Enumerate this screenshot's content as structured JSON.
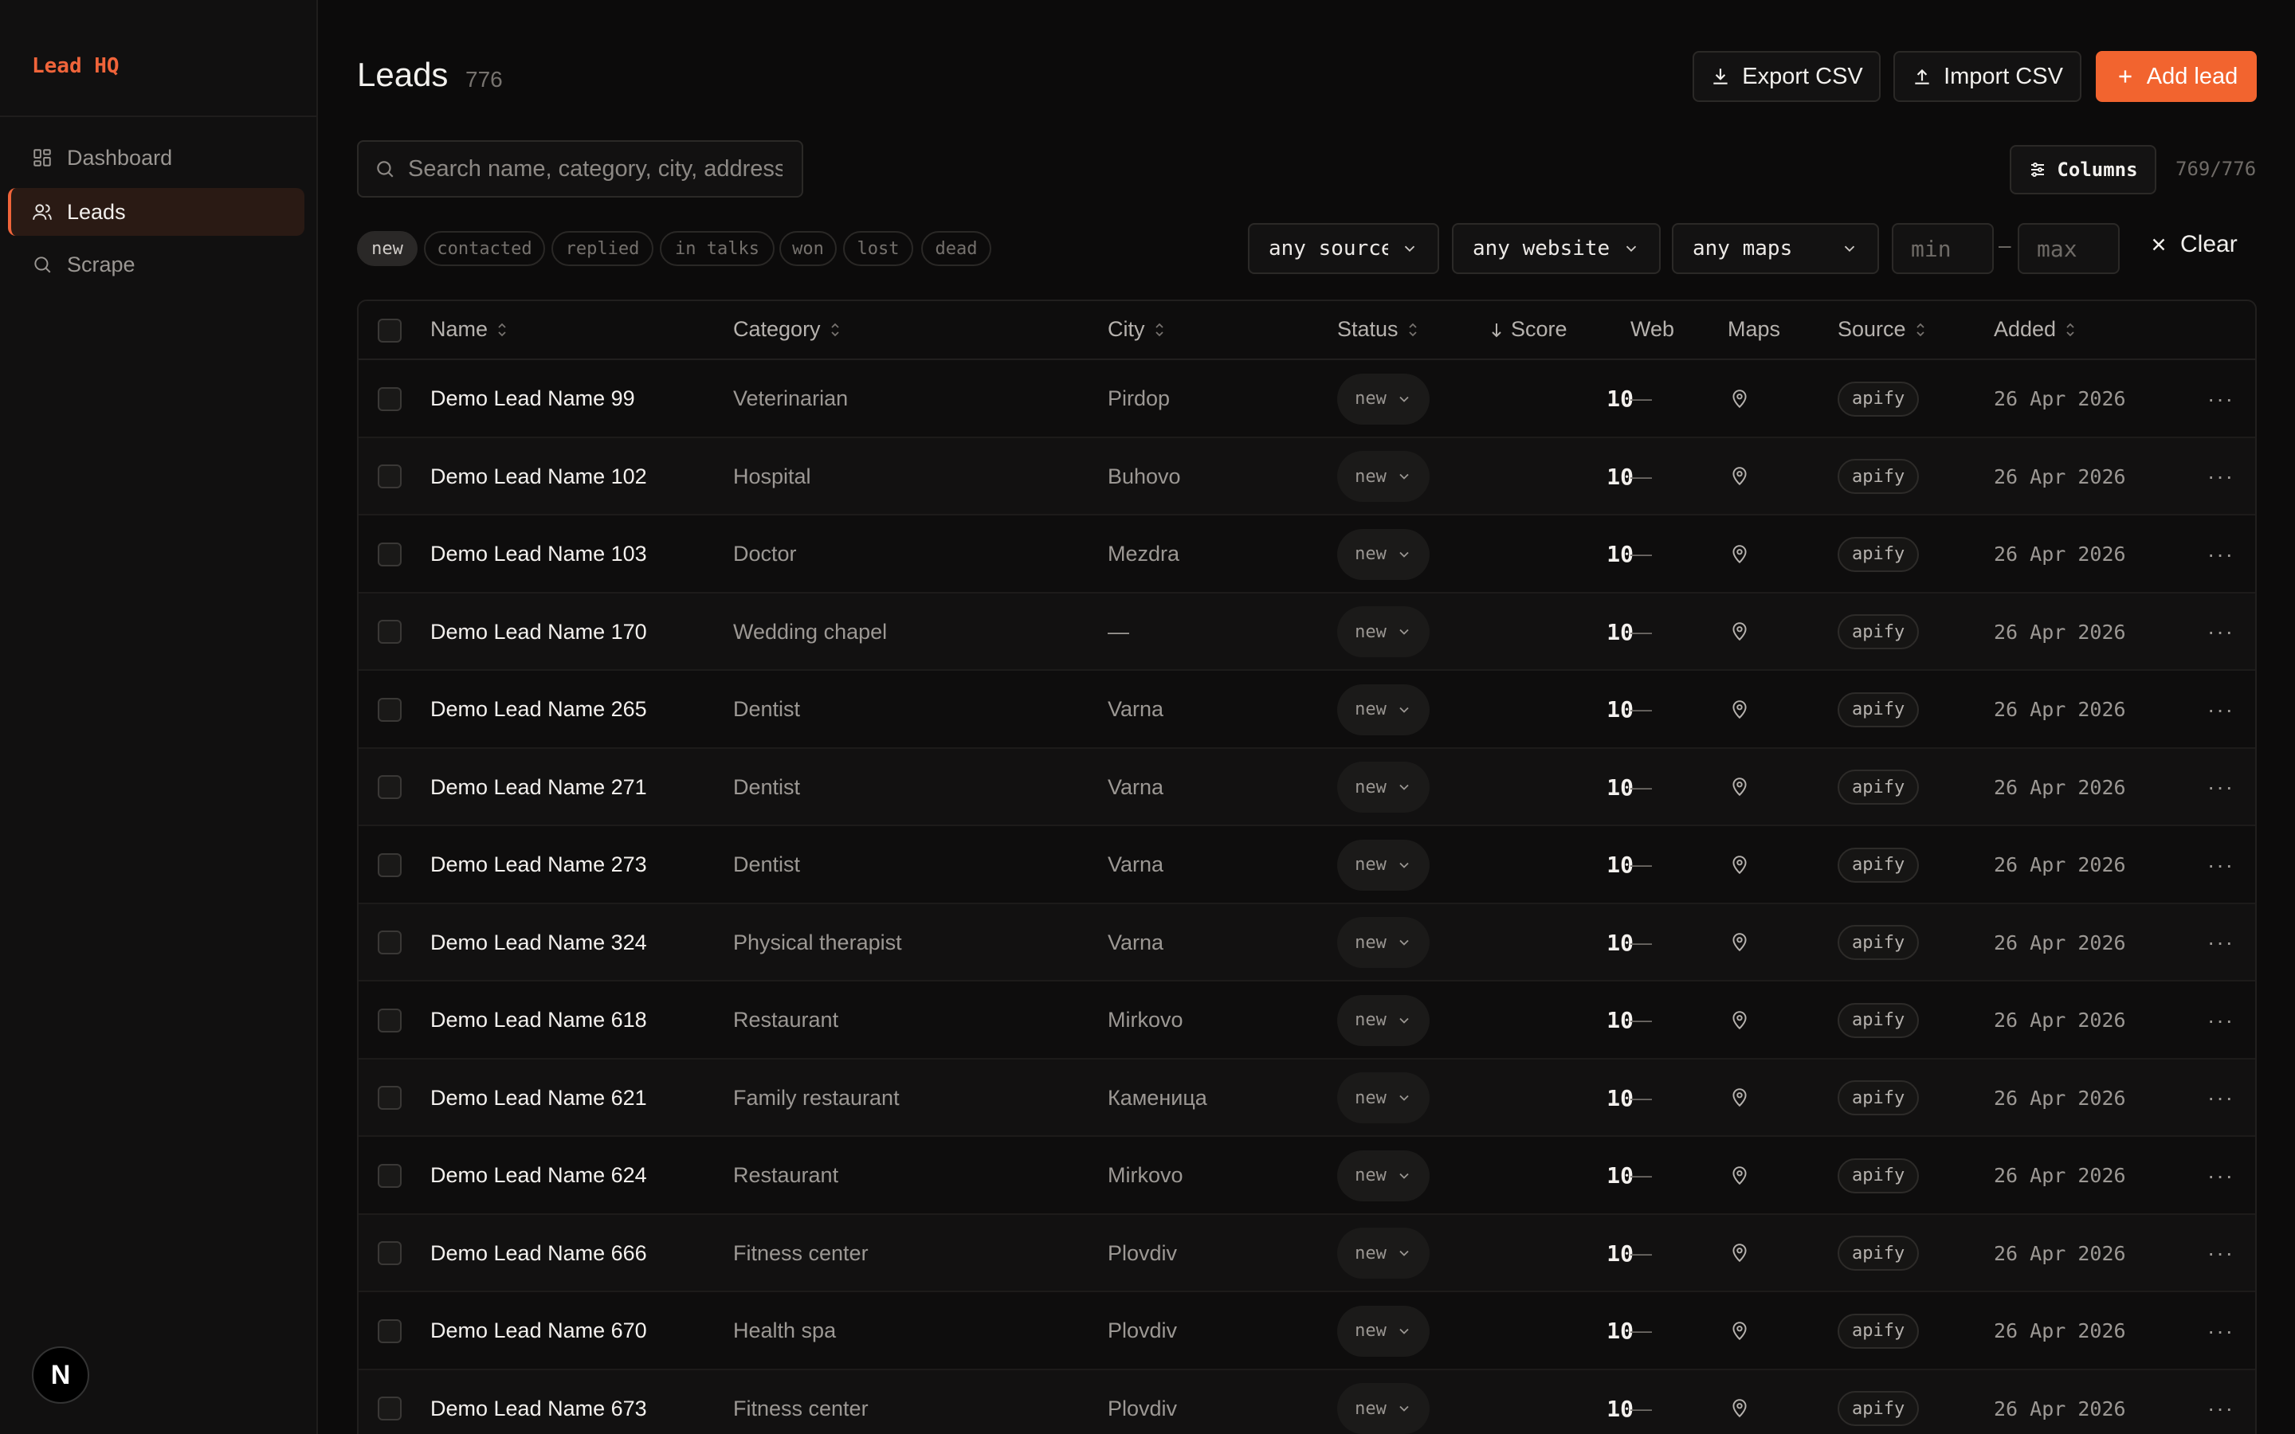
{
  "app": {
    "brand": "Lead HQ",
    "bottom_badge": "N"
  },
  "sidebar": {
    "items": [
      {
        "label": "Dashboard",
        "icon": "grid-icon",
        "active": false
      },
      {
        "label": "Leads",
        "icon": "users-icon",
        "active": true
      },
      {
        "label": "Scrape",
        "icon": "search-icon",
        "active": false
      }
    ]
  },
  "header": {
    "title": "Leads",
    "count": "776",
    "export_label": "Export CSV",
    "import_label": "Import CSV",
    "add_label": "Add lead"
  },
  "search": {
    "placeholder": "Search name, category, city, address"
  },
  "columns_button": {
    "label": "Columns"
  },
  "visible_ratio": "769/776",
  "status_chips": [
    {
      "label": "new",
      "active": true
    },
    {
      "label": "contacted",
      "active": false
    },
    {
      "label": "replied",
      "active": false
    },
    {
      "label": "in talks",
      "active": false
    },
    {
      "label": "won",
      "active": false
    },
    {
      "label": "lost",
      "active": false
    },
    {
      "label": "dead",
      "active": false
    }
  ],
  "filters": {
    "source": "any source",
    "website": "any website",
    "maps": "any maps",
    "min_placeholder": "min",
    "max_placeholder": "max",
    "range_separator": "–",
    "clear_label": "Clear"
  },
  "table": {
    "columns": {
      "name": "Name",
      "category": "Category",
      "city": "City",
      "status": "Status",
      "score": "Score",
      "web": "Web",
      "maps": "Maps",
      "source": "Source",
      "added": "Added"
    },
    "rows": [
      {
        "name": "Demo Lead Name 99",
        "category": "Veterinarian",
        "city": "Pirdop",
        "status": "new",
        "score": "10",
        "web": "—",
        "source": "apify",
        "added": "26 Apr 2026"
      },
      {
        "name": "Demo Lead Name 102",
        "category": "Hospital",
        "city": "Buhovo",
        "status": "new",
        "score": "10",
        "web": "—",
        "source": "apify",
        "added": "26 Apr 2026"
      },
      {
        "name": "Demo Lead Name 103",
        "category": "Doctor",
        "city": "Mezdra",
        "status": "new",
        "score": "10",
        "web": "—",
        "source": "apify",
        "added": "26 Apr 2026"
      },
      {
        "name": "Demo Lead Name 170",
        "category": "Wedding chapel",
        "city": "—",
        "status": "new",
        "score": "10",
        "web": "—",
        "source": "apify",
        "added": "26 Apr 2026"
      },
      {
        "name": "Demo Lead Name 265",
        "category": "Dentist",
        "city": "Varna",
        "status": "new",
        "score": "10",
        "web": "—",
        "source": "apify",
        "added": "26 Apr 2026"
      },
      {
        "name": "Demo Lead Name 271",
        "category": "Dentist",
        "city": "Varna",
        "status": "new",
        "score": "10",
        "web": "—",
        "source": "apify",
        "added": "26 Apr 2026"
      },
      {
        "name": "Demo Lead Name 273",
        "category": "Dentist",
        "city": "Varna",
        "status": "new",
        "score": "10",
        "web": "—",
        "source": "apify",
        "added": "26 Apr 2026"
      },
      {
        "name": "Demo Lead Name 324",
        "category": "Physical therapist",
        "city": "Varna",
        "status": "new",
        "score": "10",
        "web": "—",
        "source": "apify",
        "added": "26 Apr 2026"
      },
      {
        "name": "Demo Lead Name 618",
        "category": "Restaurant",
        "city": "Mirkovo",
        "status": "new",
        "score": "10",
        "web": "—",
        "source": "apify",
        "added": "26 Apr 2026"
      },
      {
        "name": "Demo Lead Name 621",
        "category": "Family restaurant",
        "city": "Каменица",
        "status": "new",
        "score": "10",
        "web": "—",
        "source": "apify",
        "added": "26 Apr 2026"
      },
      {
        "name": "Demo Lead Name 624",
        "category": "Restaurant",
        "city": "Mirkovo",
        "status": "new",
        "score": "10",
        "web": "—",
        "source": "apify",
        "added": "26 Apr 2026"
      },
      {
        "name": "Demo Lead Name 666",
        "category": "Fitness center",
        "city": "Plovdiv",
        "status": "new",
        "score": "10",
        "web": "—",
        "source": "apify",
        "added": "26 Apr 2026"
      },
      {
        "name": "Demo Lead Name 670",
        "category": "Health spa",
        "city": "Plovdiv",
        "status": "new",
        "score": "10",
        "web": "—",
        "source": "apify",
        "added": "26 Apr 2026"
      },
      {
        "name": "Demo Lead Name 673",
        "category": "Fitness center",
        "city": "Plovdiv",
        "status": "new",
        "score": "10",
        "web": "—",
        "source": "apify",
        "added": "26 Apr 2026"
      }
    ],
    "row_action": "···"
  },
  "colors": {
    "accent": "#f2642f",
    "background": "#0c0b0b",
    "sidebar": "#111010"
  }
}
